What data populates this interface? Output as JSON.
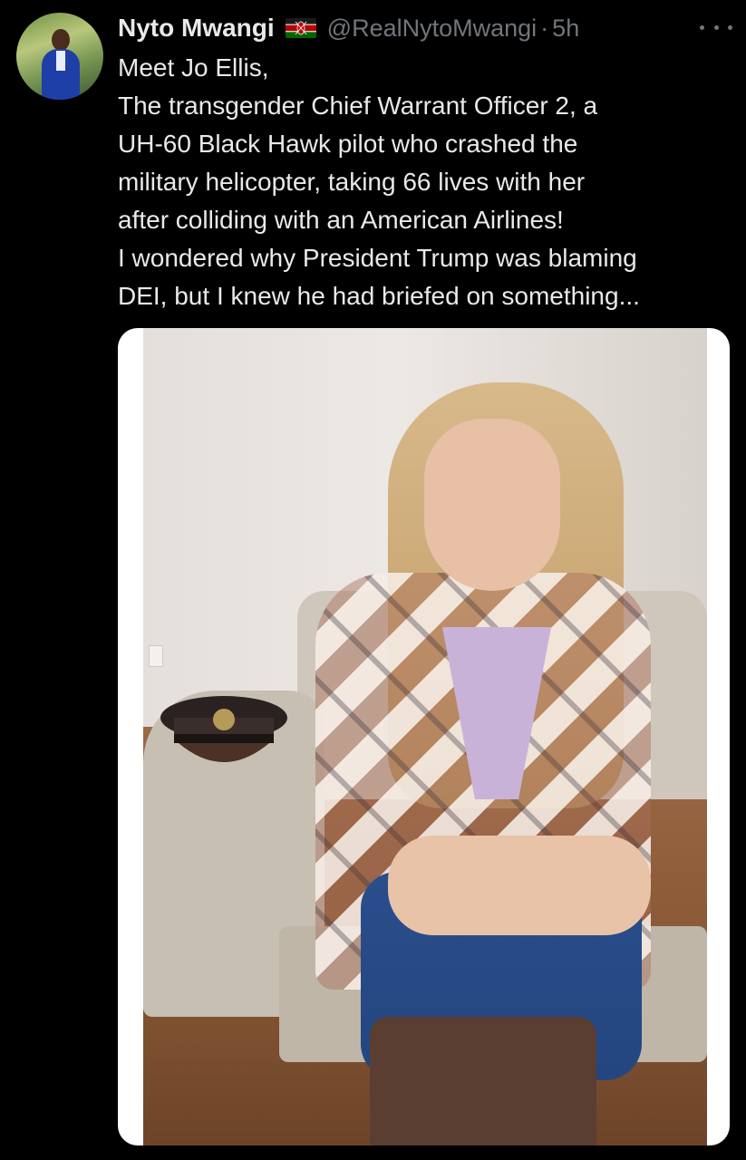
{
  "tweet": {
    "author": {
      "name": "Nyto Mwangi",
      "handle": "@RealNytoMwangi",
      "separator": "·",
      "time": "5h",
      "flag_icon": "kenya-flag-icon",
      "avatar_icon": "profile-photo"
    },
    "more_icon": "more-options-icon",
    "text_lines": [
      "Meet Jo Ellis,",
      "The transgender Chief Warrant Officer 2, a",
      "UH-60 Black Hawk pilot who crashed the",
      "military helicopter, taking 66 lives with her",
      "after colliding with an American Airlines!",
      "I wondered why President Trump was blaming",
      "DEI, but I knew he had briefed on something..."
    ],
    "media": {
      "type": "photo"
    }
  },
  "colors": {
    "background": "#000000",
    "primary_text": "#e7e9ea",
    "secondary_text": "#71767b"
  }
}
